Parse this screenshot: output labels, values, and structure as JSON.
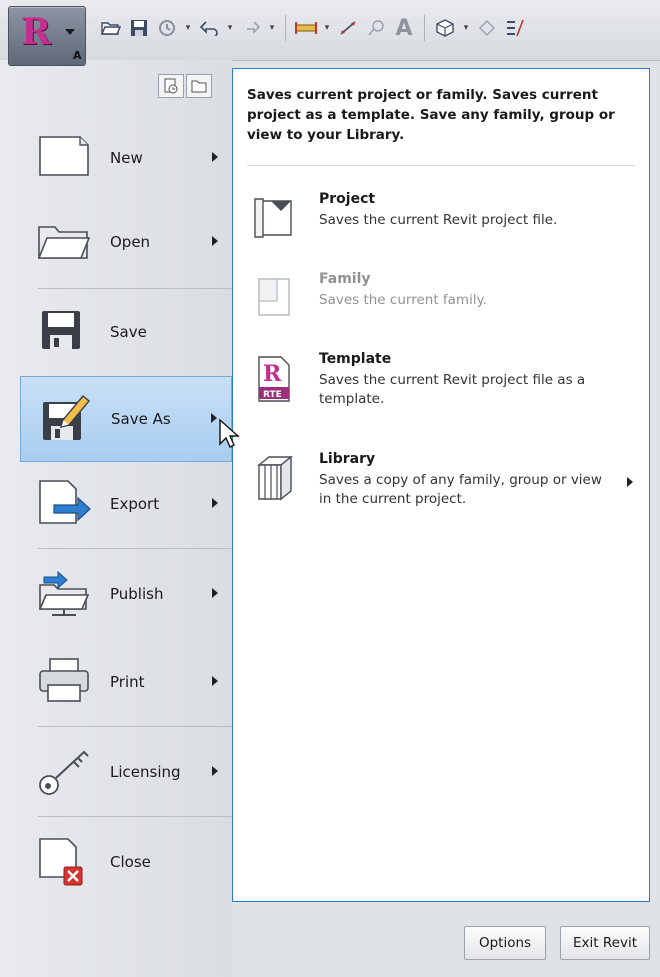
{
  "app_menu": {
    "logo_letter": "R",
    "keytip": "A"
  },
  "quick_access_toolbar": {
    "icons": [
      "open-icon",
      "save-icon",
      "sync-icon",
      "undo-icon",
      "redo-icon",
      "measure-icon",
      "dimension-icon",
      "tag-icon",
      "text-icon",
      "3d-view-icon",
      "section-icon",
      "thin-lines-icon"
    ]
  },
  "menu": {
    "items": [
      {
        "label": "New",
        "has_submenu": true,
        "icon": "new-document-icon"
      },
      {
        "label": "Open",
        "has_submenu": true,
        "icon": "open-folder-icon"
      },
      {
        "label": "Save",
        "has_submenu": false,
        "icon": "floppy-disk-icon"
      },
      {
        "label": "Save As",
        "has_submenu": true,
        "icon": "save-as-icon",
        "active": true
      },
      {
        "label": "Export",
        "has_submenu": true,
        "icon": "export-icon"
      },
      {
        "label": "Publish",
        "has_submenu": true,
        "icon": "publish-icon"
      },
      {
        "label": "Print",
        "has_submenu": true,
        "icon": "printer-icon"
      },
      {
        "label": "Licensing",
        "has_submenu": true,
        "icon": "key-icon"
      },
      {
        "label": "Close",
        "has_submenu": false,
        "icon": "close-document-icon"
      }
    ]
  },
  "submenu": {
    "description": "Saves current project or family. Saves current project as a template. Save any family, group or view to your Library.",
    "items": [
      {
        "title": "Project",
        "desc": "Saves the current Revit project file.",
        "enabled": true,
        "icon": "project-icon"
      },
      {
        "title": "Family",
        "desc": "Saves the current family.",
        "enabled": false,
        "icon": "family-icon"
      },
      {
        "title": "Template",
        "desc": "Saves the current Revit project file as a template.",
        "enabled": true,
        "icon": "template-rte-icon",
        "icon_text": "RTE"
      },
      {
        "title": "Library",
        "desc": "Saves a copy of any family, group or view in the current project.",
        "enabled": true,
        "icon": "library-icon",
        "has_submenu": true
      }
    ]
  },
  "buttons": {
    "options": "Options",
    "exit": "Exit Revit"
  },
  "colors": {
    "active_bg": "#b4d3f2",
    "submenu_border": "#2d7bc4",
    "logo": "#c22f8e"
  }
}
